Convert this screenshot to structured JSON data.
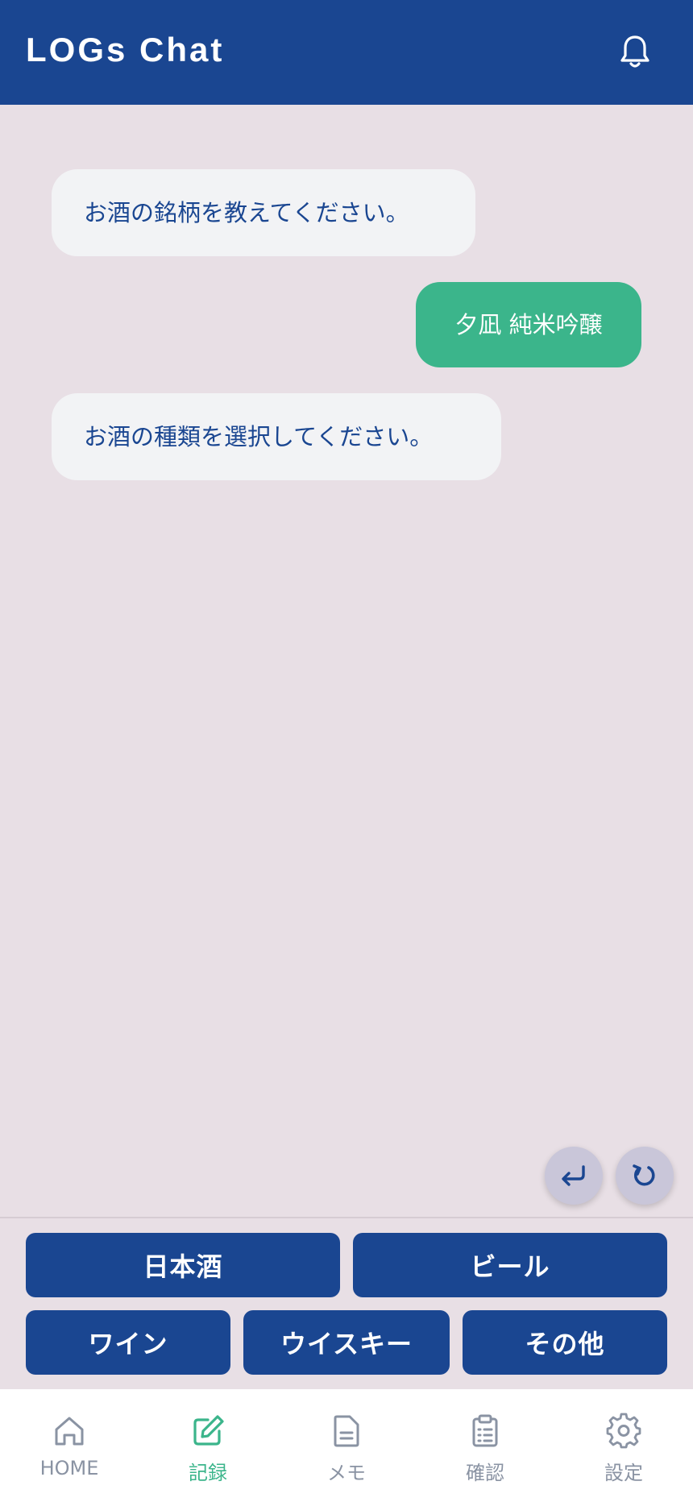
{
  "header": {
    "title": "LOGs Chat"
  },
  "chat": {
    "messages": [
      {
        "role": "bot",
        "text": "お酒の銘柄を教えてください。"
      },
      {
        "role": "user",
        "text": "夕凪 純米吟醸"
      },
      {
        "role": "bot",
        "text": "お酒の種類を選択してください。"
      }
    ]
  },
  "actions": {
    "undo_icon": "undo-arrow",
    "reset_icon": "refresh"
  },
  "options": [
    "日本酒",
    "ビール",
    "ワイン",
    "ウイスキー",
    "その他"
  ],
  "nav": {
    "items": [
      {
        "label": "HOME",
        "icon": "home"
      },
      {
        "label": "記録",
        "icon": "edit"
      },
      {
        "label": "メモ",
        "icon": "document"
      },
      {
        "label": "確認",
        "icon": "clipboard"
      },
      {
        "label": "設定",
        "icon": "gear"
      }
    ],
    "active_index": 1
  },
  "colors": {
    "primary": "#1a4691",
    "accent": "#3bb58b",
    "background": "#e8dfe5",
    "bot_bubble": "#f2f3f5",
    "nav_inactive": "#8a93a3"
  }
}
